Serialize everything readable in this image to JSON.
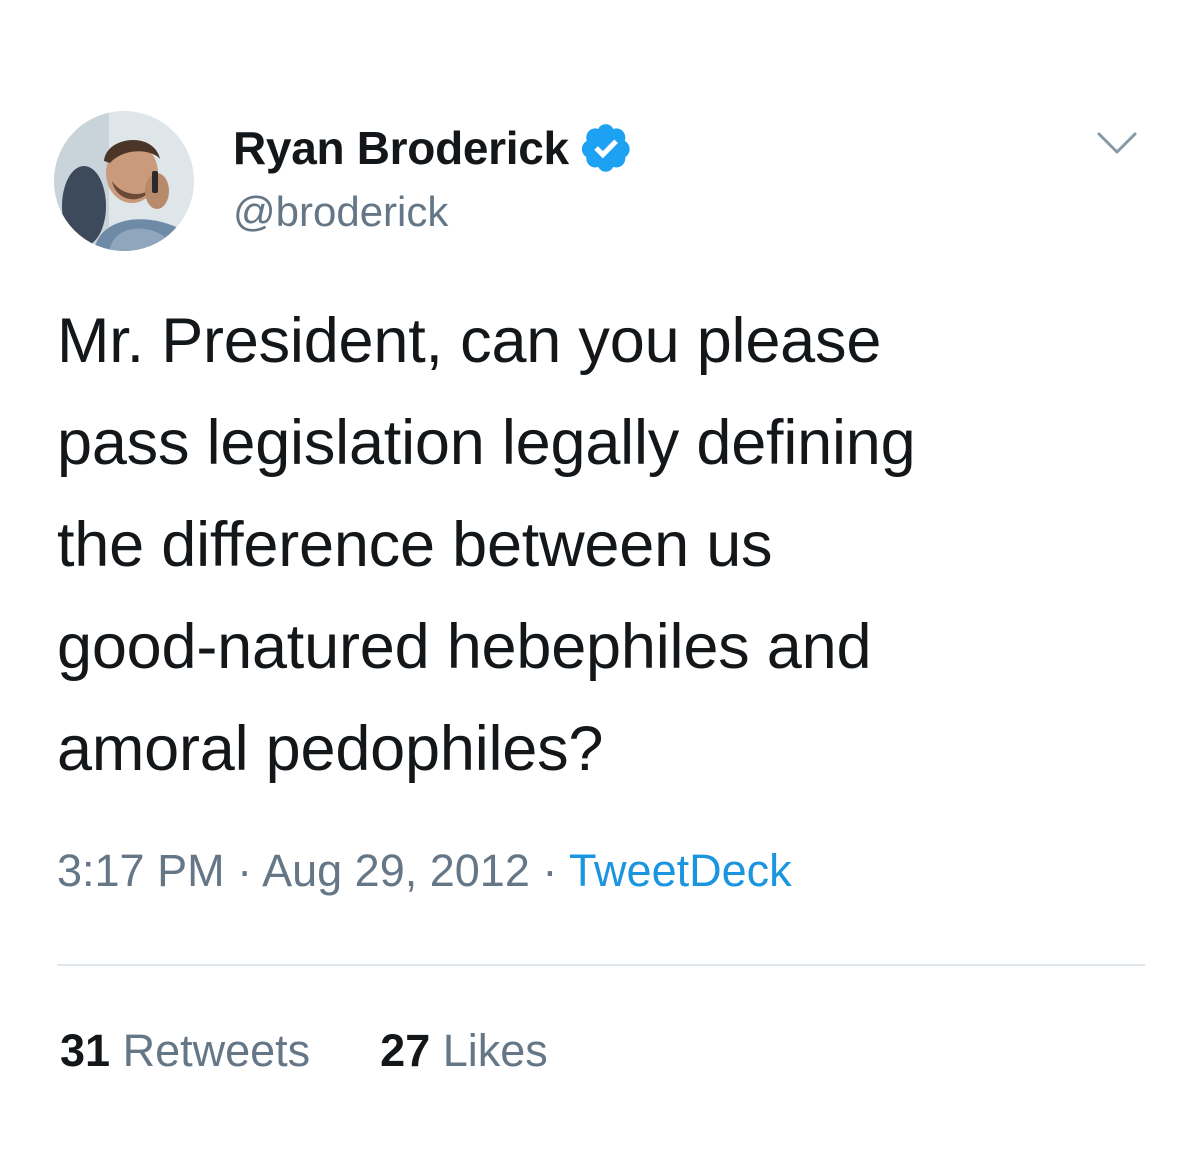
{
  "author": {
    "display_name": "Ryan Broderick",
    "handle": "@broderick",
    "verified": true,
    "avatar_icon": "user-photo-avatar",
    "verified_icon": "verified-badge-icon",
    "verified_color": "#1da1f2"
  },
  "tweet": {
    "text_lines": [
      "Mr. President, can you please",
      "pass legislation legally defining",
      "the difference between us",
      "good-natured hebephiles and",
      "amoral pedophiles?"
    ]
  },
  "meta": {
    "time": "3:17 PM",
    "separator": " · ",
    "date": "Aug 29, 2012",
    "source": "TweetDeck"
  },
  "stats": {
    "retweets_count": "31",
    "retweets_label": "Retweets",
    "likes_count": "27",
    "likes_label": "Likes"
  },
  "menu": {
    "icon": "chevron-down-icon"
  },
  "colors": {
    "text": "#14171a",
    "secondary": "#657786",
    "link": "#1b95e0",
    "divider": "#e1e8ed"
  }
}
